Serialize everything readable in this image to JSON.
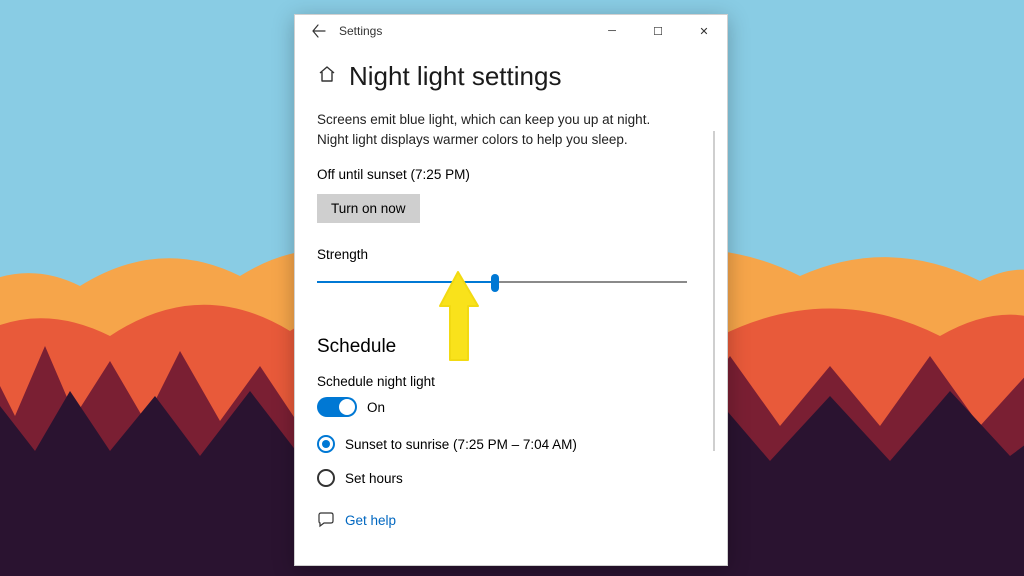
{
  "window": {
    "app_title": "Settings",
    "controls": {
      "minimize": "–",
      "maximize": "□",
      "close": "✕"
    }
  },
  "page": {
    "title": "Night light settings",
    "description": "Screens emit blue light, which can keep you up at night. Night light displays warmer colors to help you sleep.",
    "status": "Off until sunset (7:25 PM)",
    "turn_on_label": "Turn on now",
    "strength_label": "Strength",
    "strength_value_pct": 48
  },
  "schedule": {
    "heading": "Schedule",
    "toggle_caption": "Schedule night light",
    "toggle_state_label": "On",
    "options": {
      "sunset": "Sunset to sunrise (7:25 PM – 7:04 AM)",
      "set_hours": "Set hours"
    }
  },
  "help": {
    "label": "Get help"
  },
  "colors": {
    "accent": "#0078d4",
    "link": "#0067c0",
    "annotation": "#f9e21b"
  }
}
